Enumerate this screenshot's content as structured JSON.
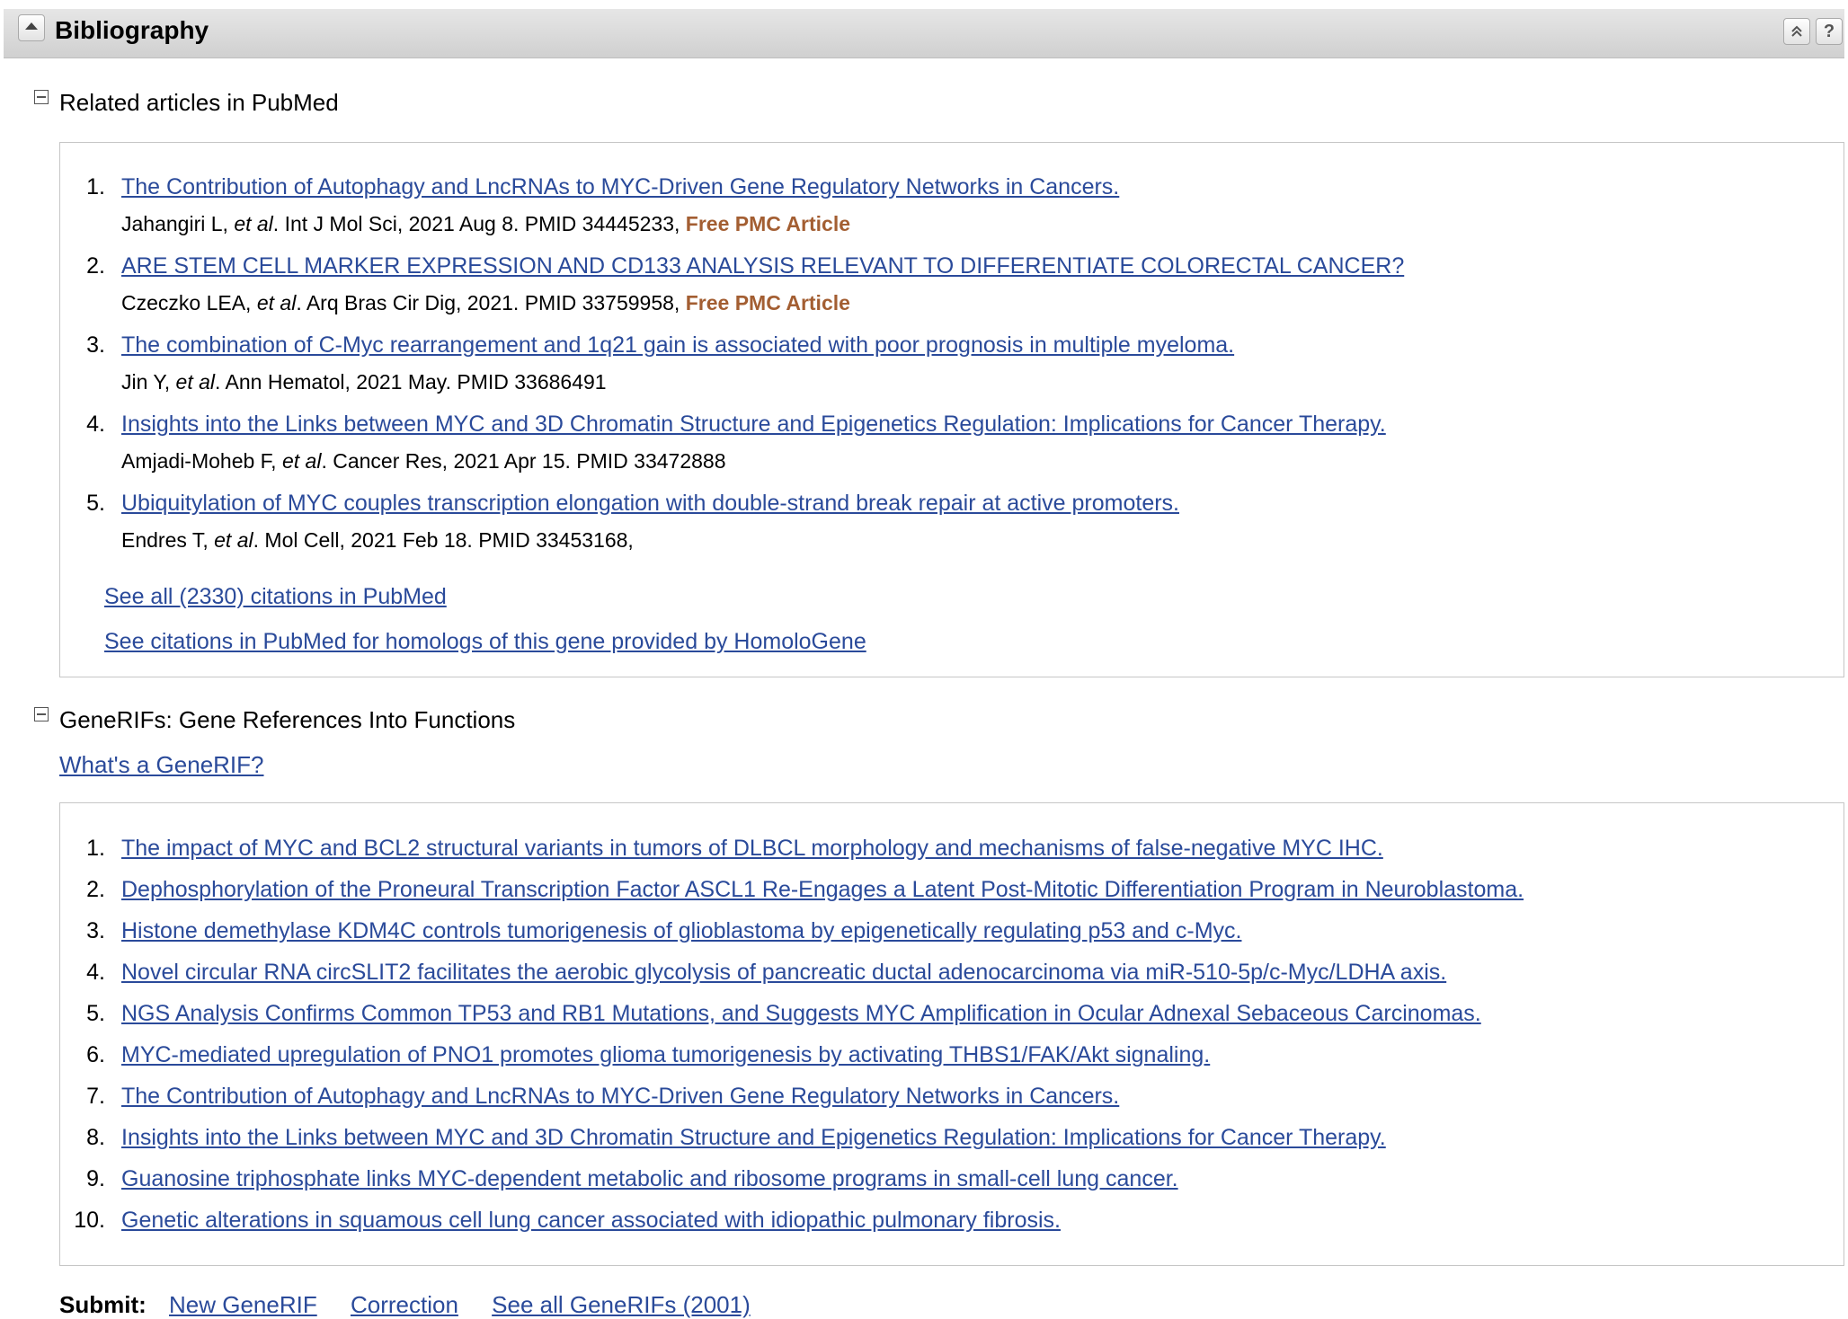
{
  "header": {
    "title": "Bibliography",
    "icons": [
      "collapse-icon",
      "scroll-top-icon",
      "help-icon"
    ],
    "help_label": "?"
  },
  "related": {
    "title": "Related articles in PubMed",
    "articles": [
      {
        "num": "1.",
        "title": "The Contribution of Autophagy and LncRNAs to MYC-Driven Gene Regulatory Networks in Cancers.",
        "authors": "Jahangiri L, ",
        "etal": "et al",
        "citation": ". Int J Mol Sci, 2021 Aug 8. PMID 34445233, ",
        "free": "Free PMC Article"
      },
      {
        "num": "2.",
        "title": "ARE STEM CELL MARKER EXPRESSION AND CD133 ANALYSIS RELEVANT TO DIFFERENTIATE COLORECTAL CANCER?",
        "authors": "Czeczko LEA, ",
        "etal": "et al",
        "citation": ". Arq Bras Cir Dig, 2021. PMID 33759958, ",
        "free": "Free PMC Article"
      },
      {
        "num": "3.",
        "title": "The combination of C-Myc rearrangement and 1q21 gain is associated with poor prognosis in multiple myeloma.",
        "authors": "Jin Y, ",
        "etal": "et al",
        "citation": ". Ann Hematol, 2021 May. PMID 33686491",
        "free": ""
      },
      {
        "num": "4.",
        "title": "Insights into the Links between MYC and 3D Chromatin Structure and Epigenetics Regulation: Implications for Cancer Therapy.",
        "authors": "Amjadi-Moheb F, ",
        "etal": "et al",
        "citation": ". Cancer Res, 2021 Apr 15. PMID 33472888",
        "free": ""
      },
      {
        "num": "5.",
        "title": "Ubiquitylation of MYC couples transcription elongation with double-strand break repair at active promoters.",
        "authors": "Endres T, ",
        "etal": "et al",
        "citation": ". Mol Cell, 2021 Feb 18. PMID 33453168,",
        "free": ""
      }
    ],
    "see_all": "See all (2330) citations in PubMed",
    "see_homologs": "See citations in PubMed for homologs of this gene provided by HomoloGene"
  },
  "generifs": {
    "title": "GeneRIFs: Gene References Into Functions",
    "whats_link": "What's a GeneRIF?",
    "items": [
      {
        "num": "1.",
        "title": "The impact of MYC and BCL2 structural variants in tumors of DLBCL morphology and mechanisms of false-negative MYC IHC."
      },
      {
        "num": "2.",
        "title": "Dephosphorylation of the Proneural Transcription Factor ASCL1 Re-Engages a Latent Post-Mitotic Differentiation Program in Neuroblastoma."
      },
      {
        "num": "3.",
        "title": "Histone demethylase KDM4C controls tumorigenesis of glioblastoma by epigenetically regulating p53 and c-Myc."
      },
      {
        "num": "4.",
        "title": "Novel circular RNA circSLIT2 facilitates the aerobic glycolysis of pancreatic ductal adenocarcinoma via miR-510-5p/c-Myc/LDHA axis."
      },
      {
        "num": "5.",
        "title": "NGS Analysis Confirms Common TP53 and RB1 Mutations, and Suggests MYC Amplification in Ocular Adnexal Sebaceous Carcinomas."
      },
      {
        "num": "6.",
        "title": "MYC-mediated upregulation of PNO1 promotes glioma tumorigenesis by activating THBS1/FAK/Akt signaling."
      },
      {
        "num": "7.",
        "title": "The Contribution of Autophagy and LncRNAs to MYC-Driven Gene Regulatory Networks in Cancers."
      },
      {
        "num": "8.",
        "title": "Insights into the Links between MYC and 3D Chromatin Structure and Epigenetics Regulation: Implications for Cancer Therapy."
      },
      {
        "num": "9.",
        "title": "Guanosine triphosphate links MYC-dependent metabolic and ribosome programs in small-cell lung cancer."
      },
      {
        "num": "10.",
        "title": "Genetic alterations in squamous cell lung cancer associated with idiopathic pulmonary fibrosis."
      }
    ],
    "submit_label": "Submit:",
    "new_generif": "New GeneRIF",
    "correction": "Correction",
    "see_all": "See all GeneRIFs (2001)"
  }
}
